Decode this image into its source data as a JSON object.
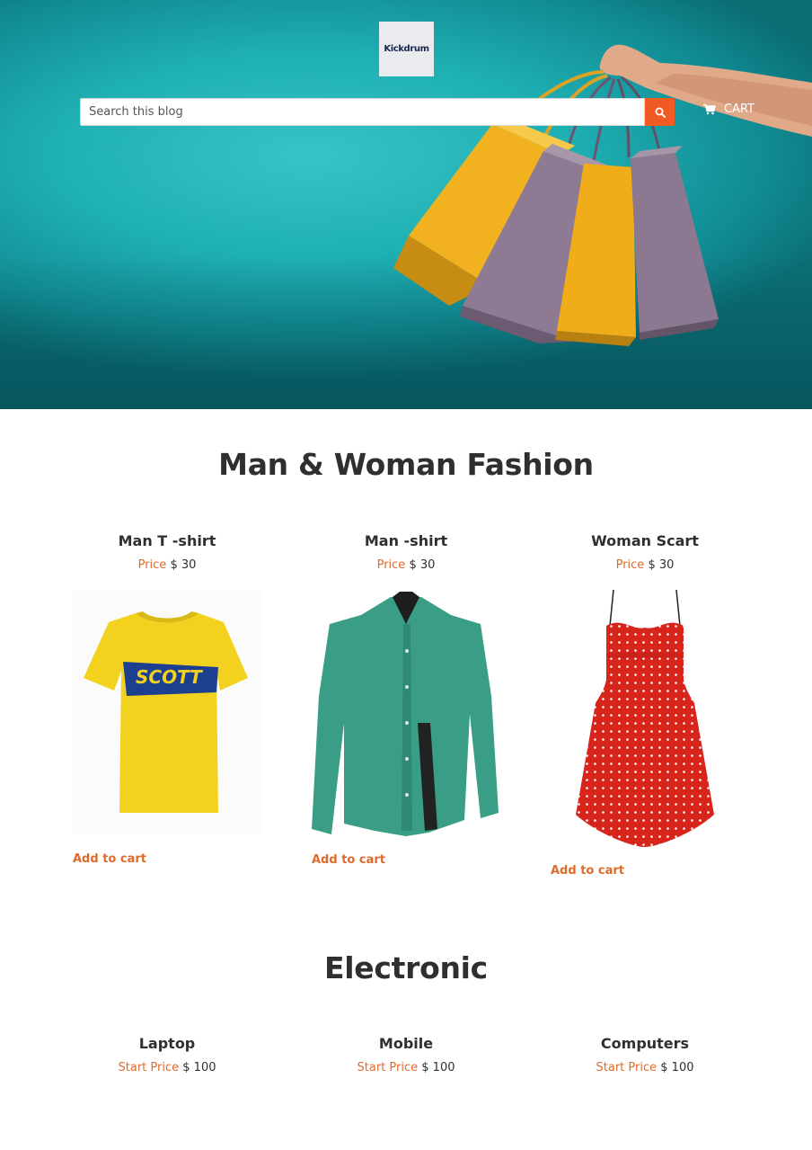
{
  "header": {
    "logo_text": "Kickdrum",
    "search_placeholder": "Search this blog",
    "search_icon": "search-icon",
    "cart_icon": "cart-icon",
    "cart_label": "CART"
  },
  "colors": {
    "accent": "#f15a22",
    "price_label": "#e06a2a",
    "hero_teal": "#1fb0b4"
  },
  "fashion": {
    "title": "Man & Woman Fashion",
    "products": [
      {
        "name": "Man T -shirt",
        "price_label": "Price",
        "price": "$ 30",
        "cta": "Add to cart"
      },
      {
        "name": "Man -shirt",
        "price_label": "Price",
        "price": "$ 30",
        "cta": "Add to cart"
      },
      {
        "name": "Woman Scart",
        "price_label": "Price",
        "price": "$ 30",
        "cta": "Add to cart"
      }
    ]
  },
  "electronic": {
    "title": "Electronic",
    "products": [
      {
        "name": "Laptop",
        "price_label": "Start Price",
        "price": "$ 100"
      },
      {
        "name": "Mobile",
        "price_label": "Start Price",
        "price": "$ 100"
      },
      {
        "name": "Computers",
        "price_label": "Start Price",
        "price": "$ 100"
      }
    ]
  }
}
